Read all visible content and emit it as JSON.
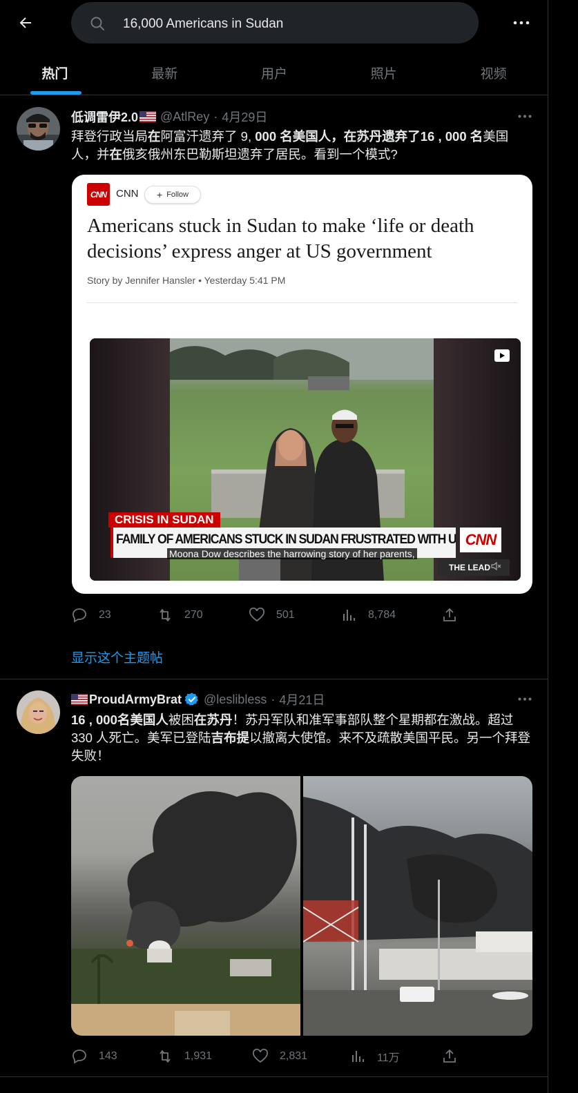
{
  "header": {
    "search_value": "16,000 Americans in Sudan"
  },
  "tabs": [
    {
      "label": "热门",
      "active": true
    },
    {
      "label": "最新",
      "active": false
    },
    {
      "label": "用户",
      "active": false
    },
    {
      "label": "照片",
      "active": false
    },
    {
      "label": "视频",
      "active": false
    }
  ],
  "colors": {
    "accent": "#1d9bf0",
    "background": "#000000",
    "muted": "#71767b",
    "verified": "#1d9bf0",
    "cnn_red": "#cc0000"
  },
  "tweets": [
    {
      "name": "低调雷伊2.0",
      "name_flag": "us-flag-icon",
      "handle": "@AtlRey",
      "sep": "·",
      "date": "4月29日",
      "text_parts": [
        "拜登行政当局",
        "在",
        "阿富汗遗弃了 9,",
        " 000 名美国人，在苏丹遗弃了16 , 000 名",
        "美国人，并",
        "在",
        "俄亥俄州东巴勒斯坦遗弃了居民。看到一个模式?"
      ],
      "card": {
        "logo": "CNN",
        "source": "CNN",
        "follow_label": "Follow",
        "title": "Americans stuck in Sudan to make ‘life or death decisions’ express anger at US government",
        "byline": "Story by Jennifer Hansler • Yesterday 5:41 PM",
        "video": {
          "lower_third_label": "CRISIS IN SUDAN",
          "lower_third_text": "FAMILY OF AMERICANS STUCK IN SUDAN FRUSTRATED WITH U.S. GOVT RESPONSE",
          "network_logo": "CNN",
          "caption": "Moona Dow describes the harrowing story of her parents,",
          "show_tag": "THE LEAD"
        }
      },
      "replies": "23",
      "reposts": "270",
      "likes": "501",
      "views": "8,784",
      "thread_link": "显示这个主题帖"
    },
    {
      "name": "ProudArmyBrat",
      "name_flag": "us-flag-icon",
      "verified": true,
      "handle": "@leslibless",
      "sep": "·",
      "date": "4月21日",
      "text_parts": [
        "16 , 000名美国人",
        "被困",
        "在苏丹",
        "！苏丹军队和准军事部队整个星期都在激战。超过 330 人死亡。美军已登陆",
        "吉布提",
        "以撤离大使馆。来不及疏散美国平民。另一个拜登失败！"
      ],
      "replies": "143",
      "reposts": "1,931",
      "likes": "2,831",
      "views": "11万"
    }
  ]
}
